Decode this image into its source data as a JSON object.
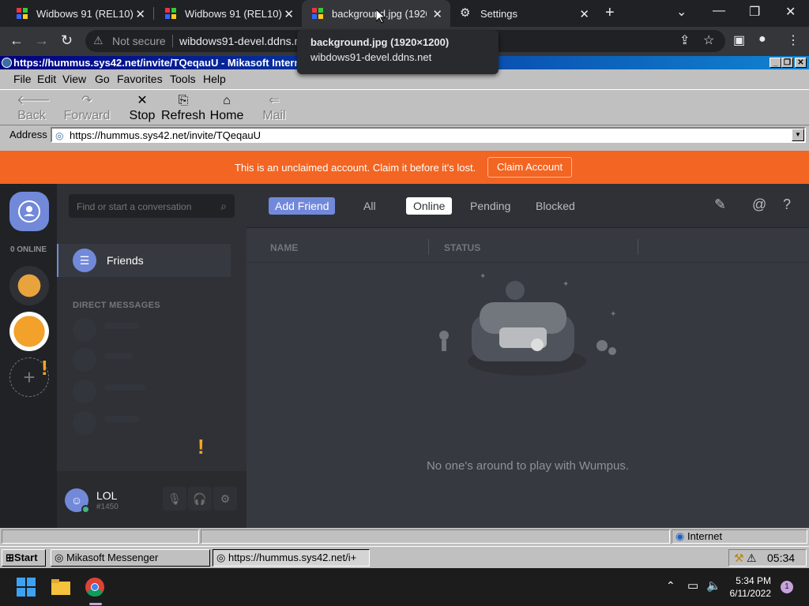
{
  "chrome": {
    "tabs": [
      {
        "title": "Widbows 91 (REL10)",
        "close": "✕"
      },
      {
        "title": "Widbows 91 (REL10)",
        "close": "✕"
      },
      {
        "title": "background.jpg (1920×",
        "close": "✕"
      },
      {
        "title": "Settings",
        "close": "✕"
      }
    ],
    "new_tab": "+",
    "controls": {
      "dropdown": "⌄",
      "minimize": "—",
      "restore": "❐",
      "close": "✕"
    },
    "omnibox": {
      "security": "Not secure",
      "url": "wibdows91-devel.ddns.n"
    },
    "tooltip": {
      "title": "background.jpg (1920×1200)",
      "host": "wibdows91-devel.ddns.net"
    }
  },
  "retro_window": {
    "title": "https://hummus.sys42.net/invite/TQeqauU - Mikasoft Internet",
    "menu": [
      "File",
      "Edit",
      "View",
      "Go",
      "Favorites",
      "Tools",
      "Help"
    ],
    "toolbar": {
      "back": "Back",
      "forward": "Forward",
      "stop": "Stop",
      "refresh": "Refresh",
      "home": "Home",
      "mail": "Mail"
    },
    "address_label": "Address",
    "address_value": "https://hummus.sys42.net/invite/TQeqauU",
    "status_zone": "Internet"
  },
  "discord": {
    "banner": {
      "message": "This is an unclaimed account. Claim it before it's lost.",
      "button": "Claim Account"
    },
    "online_count": "0 ONLINE",
    "search_placeholder": "Find or start a conversation",
    "friends_label": "Friends",
    "dm_header": "DIRECT MESSAGES",
    "user": {
      "name": "LOL",
      "tag": "#1450"
    },
    "header": {
      "add_friend": "Add Friend",
      "tabs": [
        "All",
        "Online",
        "Pending",
        "Blocked"
      ],
      "selected_tab": "Online"
    },
    "columns": [
      "NAME",
      "STATUS"
    ],
    "empty_message": "No one's around to play with Wumpus."
  },
  "retro_taskbar": {
    "start": "Start",
    "items": [
      "Mikasoft Messenger",
      "https://hummus.sys42.net/i+"
    ],
    "clock": "05:34"
  },
  "os_taskbar": {
    "time": "5:34 PM",
    "date": "6/11/2022",
    "notifications": "1"
  },
  "colors": {
    "banner": "#f26522",
    "blurple": "#7289da",
    "online": "#43b581"
  }
}
